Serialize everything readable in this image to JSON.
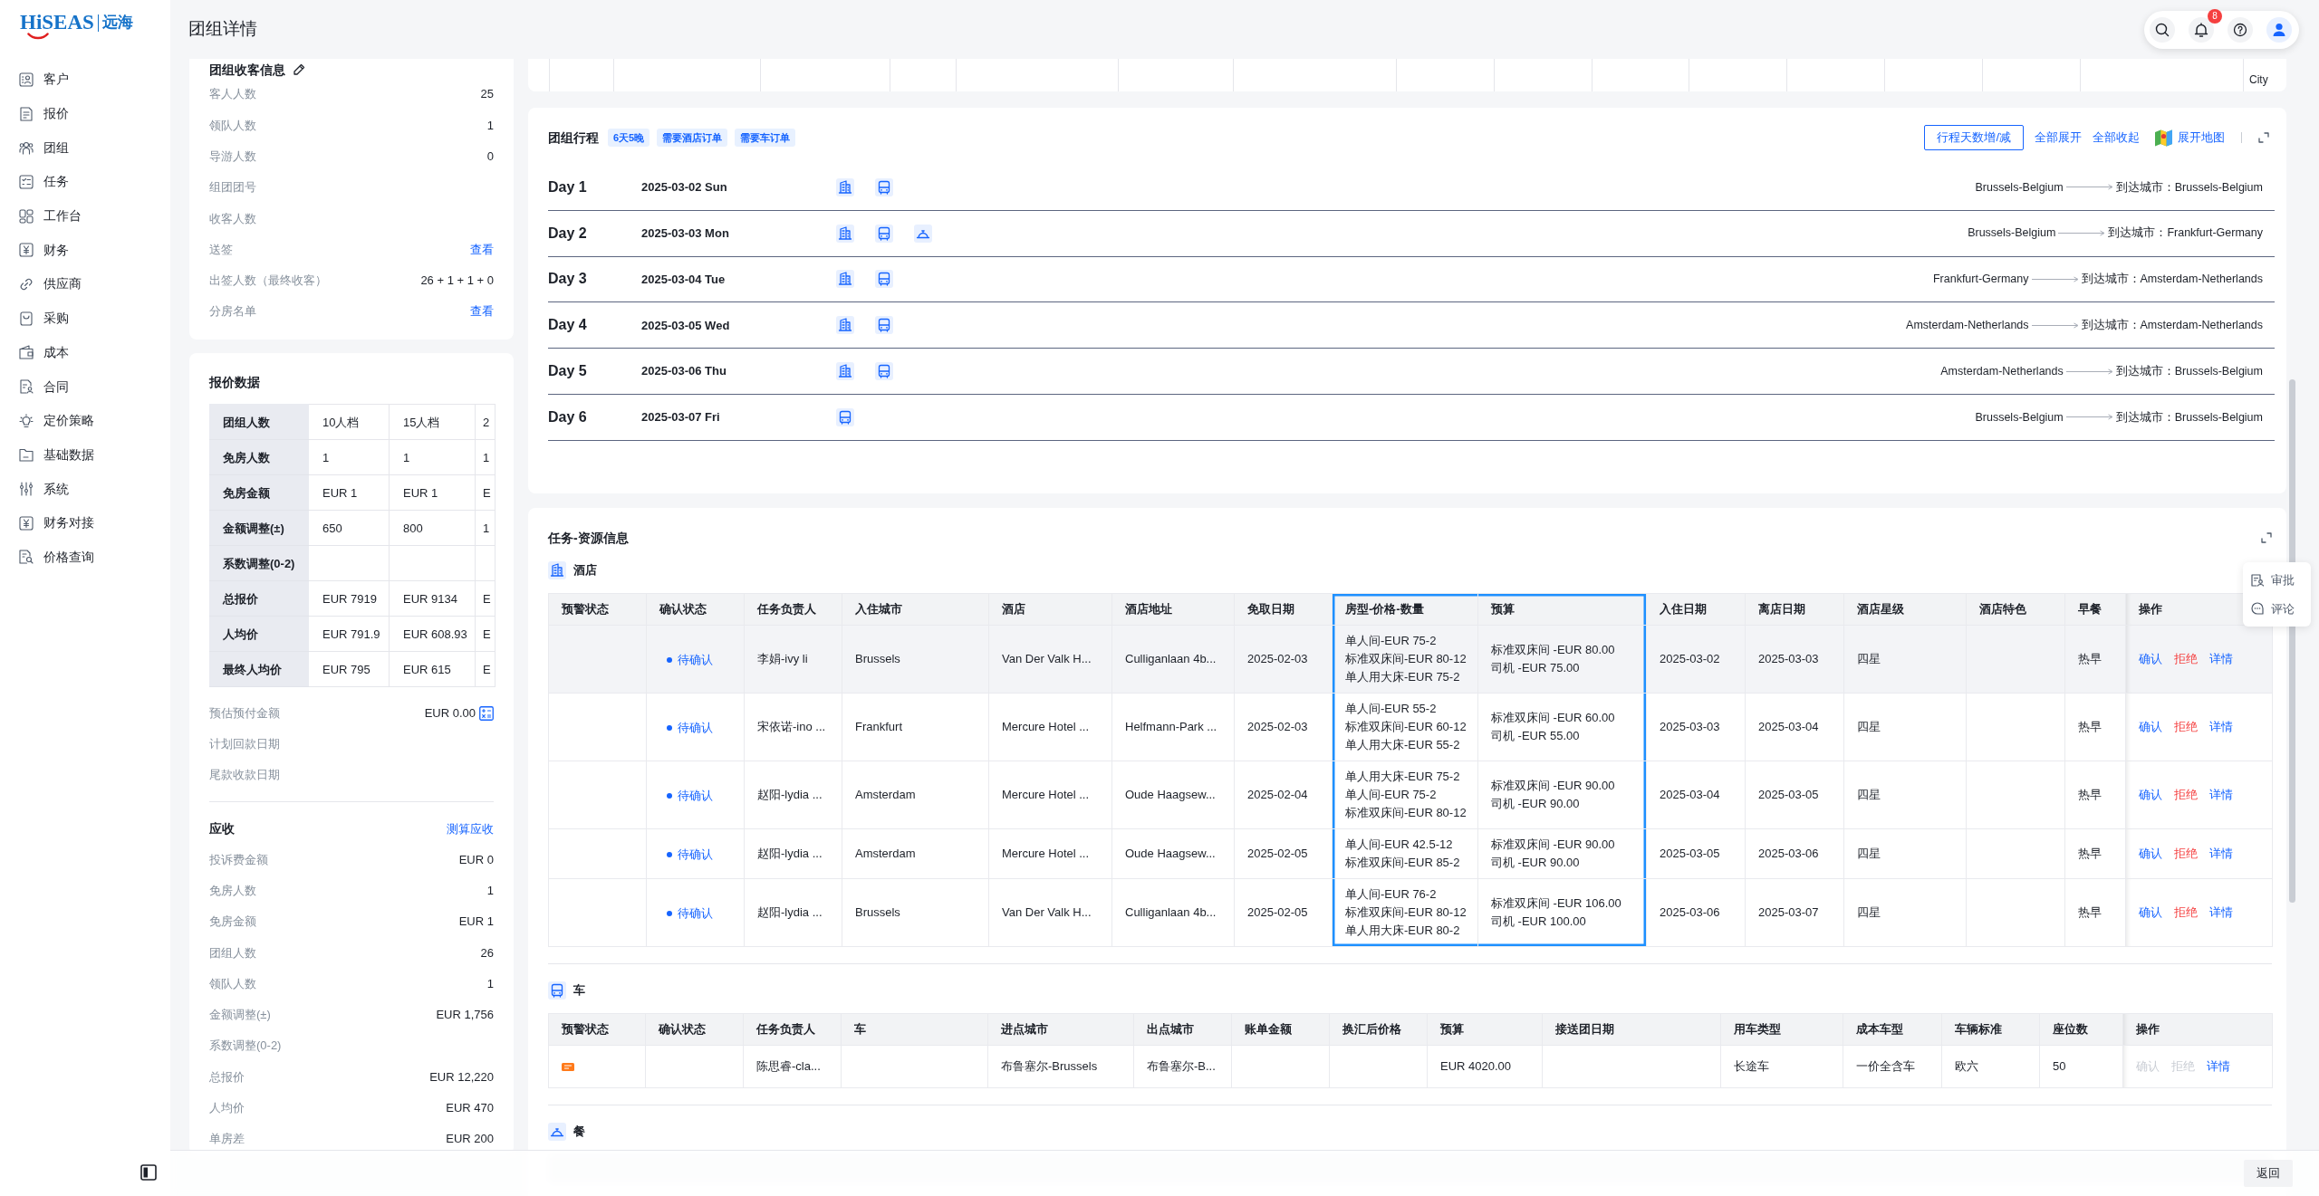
{
  "sidebar": {
    "logo": {
      "latin": "HiSEAS",
      "chinese": "远海"
    },
    "items": [
      {
        "label": "客户",
        "selected": false
      },
      {
        "label": "报价",
        "selected": false
      },
      {
        "label": "团组",
        "selected": false
      },
      {
        "label": "任务",
        "selected": false
      },
      {
        "label": "工作台",
        "selected": false
      },
      {
        "label": "财务",
        "selected": false
      },
      {
        "label": "供应商",
        "selected": false
      },
      {
        "label": "采购",
        "selected": false
      },
      {
        "label": "成本",
        "selected": false
      },
      {
        "label": "合同",
        "selected": false
      },
      {
        "label": "定价策略",
        "selected": false
      },
      {
        "label": "基础数据",
        "selected": false
      },
      {
        "label": "系统",
        "selected": false
      },
      {
        "label": "财务对接",
        "selected": false
      },
      {
        "label": "价格查询",
        "selected": false
      }
    ]
  },
  "header": {
    "title": "团组详情",
    "notification_count": "8"
  },
  "group_info": {
    "title": "团组收客信息",
    "rows": [
      {
        "kind": "value",
        "label": "客人人数",
        "value": "25"
      },
      {
        "kind": "value",
        "label": "领队人数",
        "value": "1"
      },
      {
        "kind": "value",
        "label": "导游人数",
        "value": "0"
      },
      {
        "kind": "value",
        "label": "组团团号"
      },
      {
        "kind": "value",
        "label": "收客人数"
      },
      {
        "kind": "link",
        "label": "送签",
        "value": "查看"
      },
      {
        "kind": "value",
        "label": "出签人数（最终收客）",
        "value": "26 + 1 + 1 + 0"
      },
      {
        "kind": "link",
        "label": "分房名单",
        "value": "查看"
      }
    ]
  },
  "quote": {
    "title": "报价数据",
    "table": [
      {
        "label": "团组人数",
        "cells": [
          "10人档",
          "15人档",
          "2"
        ]
      },
      {
        "label": "免房人数",
        "cells": [
          "1",
          "1",
          "1"
        ]
      },
      {
        "label": "免房金额",
        "cells": [
          "EUR 1",
          "EUR 1",
          "E"
        ]
      },
      {
        "label": "金额调整(±)",
        "cells": [
          "650",
          "800",
          "1"
        ]
      },
      {
        "label": "系数调整(0-2)"
      },
      {
        "label": "总报价",
        "cells": [
          "EUR 7919",
          "EUR 9134",
          "E"
        ]
      },
      {
        "label": "人均价",
        "cells": [
          "EUR 791.9",
          "EUR 608.93",
          "E"
        ]
      },
      {
        "label": "最终人均价",
        "cells": [
          "EUR 795",
          "EUR 615",
          "E"
        ]
      }
    ],
    "details": [
      {
        "kind": "calculator",
        "label": "预估预付金额",
        "value": "EUR 0.00"
      },
      {
        "kind": "value",
        "label": "计划回款日期"
      },
      {
        "kind": "value",
        "label": "尾款收款日期"
      }
    ],
    "receivable": {
      "title": "应收",
      "link": "测算应收",
      "rows": [
        {
          "label": "投诉费金额",
          "value": "EUR 0"
        },
        {
          "label": "免房人数",
          "value": "1"
        },
        {
          "label": "免房金额",
          "value": "EUR 1"
        },
        {
          "label": "团组人数",
          "value": "26"
        },
        {
          "label": "领队人数",
          "value": "1"
        },
        {
          "label": "金额调整(±)",
          "value": "EUR 1,756"
        },
        {
          "label": "系数调整(0-2)"
        },
        {
          "label": "总报价",
          "value": "EUR 12,220"
        },
        {
          "label": "人均价",
          "value": "EUR 470"
        },
        {
          "label": "单房差",
          "value": "EUR 200"
        }
      ]
    }
  },
  "table_strip": {
    "last_cell": "City"
  },
  "itinerary": {
    "title": "团组行程",
    "tags": [
      "6天5晚",
      "需要酒店订单",
      "需要车订单"
    ],
    "adjust_button": "行程天数增/减",
    "expand_all": "全部展开",
    "collapse_all": "全部收起",
    "map_link": "展开地图",
    "days": [
      {
        "day": "Day 1",
        "date": "2025-03-02 Sun",
        "services": [
          {
            "kind": "hotel"
          },
          {
            "kind": "bus"
          }
        ],
        "from": "Brussels-Belgium",
        "to": "到达城市：Brussels-Belgium"
      },
      {
        "day": "Day 2",
        "date": "2025-03-03 Mon",
        "services": [
          {
            "kind": "hotel"
          },
          {
            "kind": "bus"
          },
          {
            "kind": "meal"
          }
        ],
        "from": "Brussels-Belgium",
        "to": "到达城市：Frankfurt-Germany"
      },
      {
        "day": "Day 3",
        "date": "2025-03-04 Tue",
        "services": [
          {
            "kind": "hotel"
          },
          {
            "kind": "bus"
          }
        ],
        "from": "Frankfurt-Germany",
        "to": "到达城市：Amsterdam-Netherlands"
      },
      {
        "day": "Day 4",
        "date": "2025-03-05 Wed",
        "services": [
          {
            "kind": "hotel"
          },
          {
            "kind": "bus"
          }
        ],
        "from": "Amsterdam-Netherlands",
        "to": "到达城市：Amsterdam-Netherlands"
      },
      {
        "day": "Day 5",
        "date": "2025-03-06 Thu",
        "services": [
          {
            "kind": "hotel"
          },
          {
            "kind": "bus"
          }
        ],
        "from": "Amsterdam-Netherlands",
        "to": "到达城市：Brussels-Belgium"
      },
      {
        "day": "Day 6",
        "date": "2025-03-07 Fri",
        "services": [
          {
            "kind": "bus"
          }
        ],
        "from": "Brussels-Belgium",
        "to": "到达城市：Brussels-Belgium"
      }
    ]
  },
  "tasks": {
    "title": "任务-资源信息",
    "sections": [
      {
        "kind": "hotel",
        "title": "酒店",
        "columns": [
          {
            "label": "预警状态",
            "framed": false
          },
          {
            "label": "确认状态",
            "framed": false
          },
          {
            "label": "任务负责人",
            "framed": false
          },
          {
            "label": "入住城市",
            "framed": false
          },
          {
            "label": "酒店",
            "framed": false
          },
          {
            "label": "酒店地址",
            "framed": false
          },
          {
            "label": "免取日期",
            "framed": false
          },
          {
            "label": "房型-价格-数量",
            "framed": true
          },
          {
            "label": "预算",
            "framed": true
          },
          {
            "label": "入住日期",
            "framed": false
          },
          {
            "label": "离店日期",
            "framed": false
          },
          {
            "label": "酒店星级",
            "framed": false
          },
          {
            "label": "酒店特色",
            "framed": false
          },
          {
            "label": "早餐",
            "framed": false
          },
          {
            "label": "操作",
            "framed": false
          }
        ],
        "rows": [
          {
            "highlighted": true,
            "warning_flag": false,
            "status": "待确认",
            "owner": "李娟-ivy li",
            "city": "Brussels",
            "hotel": "Van Der Valk H...",
            "address": "Culliganlaan 4b...",
            "free_date": "2025-02-03",
            "rooms": [
              "单人间-EUR 75-2",
              "标准双床间-EUR 80-12",
              "单人用大床-EUR 75-2"
            ],
            "budget": [
              "标准双床间 -EUR 80.00",
              "司机 -EUR 75.00"
            ],
            "check_in": "2025-03-02",
            "check_out": "2025-03-03",
            "star_rating": "四星",
            "breakfast": "热早",
            "actions": [
              {
                "kind": "confirm",
                "label": "确认",
                "disabled": false
              },
              {
                "kind": "reject",
                "label": "拒绝",
                "disabled": false
              },
              {
                "kind": "detail",
                "label": "详情",
                "disabled": false
              }
            ]
          },
          {
            "highlighted": false,
            "warning_flag": false,
            "status": "待确认",
            "owner": "宋依诺-ino ...",
            "city": "Frankfurt",
            "hotel": "Mercure Hotel ...",
            "address": "Helfmann-Park ...",
            "free_date": "2025-02-03",
            "rooms": [
              "单人间-EUR 55-2",
              "标准双床间-EUR 60-12",
              "单人用大床-EUR 55-2"
            ],
            "budget": [
              "标准双床间 -EUR 60.00",
              "司机 -EUR 55.00"
            ],
            "check_in": "2025-03-03",
            "check_out": "2025-03-04",
            "star_rating": "四星",
            "breakfast": "热早",
            "actions": [
              {
                "kind": "confirm",
                "label": "确认",
                "disabled": false
              },
              {
                "kind": "reject",
                "label": "拒绝",
                "disabled": false
              },
              {
                "kind": "detail",
                "label": "详情",
                "disabled": false
              }
            ]
          },
          {
            "highlighted": false,
            "warning_flag": false,
            "status": "待确认",
            "owner": "赵阳-lydia ...",
            "city": "Amsterdam",
            "hotel": "Mercure Hotel ...",
            "address": "Oude Haagsew...",
            "free_date": "2025-02-04",
            "rooms": [
              "单人用大床-EUR 75-2",
              "单人间-EUR 75-2",
              "标准双床间-EUR 80-12"
            ],
            "budget": [
              "标准双床间 -EUR 90.00",
              "司机 -EUR 90.00"
            ],
            "check_in": "2025-03-04",
            "check_out": "2025-03-05",
            "star_rating": "四星",
            "breakfast": "热早",
            "actions": [
              {
                "kind": "confirm",
                "label": "确认",
                "disabled": false
              },
              {
                "kind": "reject",
                "label": "拒绝",
                "disabled": false
              },
              {
                "kind": "detail",
                "label": "详情",
                "disabled": false
              }
            ]
          },
          {
            "highlighted": false,
            "warning_flag": false,
            "status": "待确认",
            "owner": "赵阳-lydia ...",
            "city": "Amsterdam",
            "hotel": "Mercure Hotel ...",
            "address": "Oude Haagsew...",
            "free_date": "2025-02-05",
            "rooms": [
              "单人间-EUR 42.5-12",
              "标准双床间-EUR 85-2"
            ],
            "budget": [
              "标准双床间 -EUR 90.00",
              "司机 -EUR 90.00"
            ],
            "check_in": "2025-03-05",
            "check_out": "2025-03-06",
            "star_rating": "四星",
            "breakfast": "热早",
            "actions": [
              {
                "kind": "confirm",
                "label": "确认",
                "disabled": false
              },
              {
                "kind": "reject",
                "label": "拒绝",
                "disabled": false
              },
              {
                "kind": "detail",
                "label": "详情",
                "disabled": false
              }
            ]
          },
          {
            "highlighted": false,
            "warning_flag": false,
            "status": "待确认",
            "owner": "赵阳-lydia ...",
            "city": "Brussels",
            "hotel": "Van Der Valk H...",
            "address": "Culliganlaan 4b...",
            "free_date": "2025-02-05",
            "rooms": [
              "单人间-EUR 76-2",
              "标准双床间-EUR 80-12",
              "单人用大床-EUR 80-2"
            ],
            "budget": [
              "标准双床间 -EUR 106.00",
              "司机 -EUR 100.00"
            ],
            "check_in": "2025-03-06",
            "check_out": "2025-03-07",
            "star_rating": "四星",
            "breakfast": "热早",
            "actions": [
              {
                "kind": "confirm",
                "label": "确认",
                "disabled": false
              },
              {
                "kind": "reject",
                "label": "拒绝",
                "disabled": false
              },
              {
                "kind": "detail",
                "label": "详情",
                "disabled": false
              }
            ]
          }
        ]
      },
      {
        "kind": "car",
        "title": "车",
        "columns": [
          {
            "label": "预警状态",
            "framed": false
          },
          {
            "label": "确认状态",
            "framed": false
          },
          {
            "label": "任务负责人",
            "framed": false
          },
          {
            "label": "车",
            "framed": false
          },
          {
            "label": "进点城市",
            "framed": false
          },
          {
            "label": "出点城市",
            "framed": false
          },
          {
            "label": "账单金额",
            "framed": false
          },
          {
            "label": "换汇后价格",
            "framed": false
          },
          {
            "label": "预算",
            "framed": false
          },
          {
            "label": "接送团日期",
            "framed": false
          },
          {
            "label": "用车类型",
            "framed": false
          },
          {
            "label": "成本车型",
            "framed": false
          },
          {
            "label": "车辆标准",
            "framed": false
          },
          {
            "label": "座位数",
            "framed": false
          },
          {
            "label": "操作",
            "framed": false
          }
        ],
        "rows": [
          {
            "warning_flag": true,
            "owner": "陈思睿-cla...",
            "entry_city": "布鲁塞尔-Brussels",
            "exit_city": "布鲁塞尔-B...",
            "budget": "EUR 4020.00",
            "usage_type": "长途车",
            "cost_model": "一价全含车",
            "standard": "欧六",
            "seats": "50",
            "actions": [
              {
                "kind": "confirm",
                "label": "确认",
                "disabled": true
              },
              {
                "kind": "reject",
                "label": "拒绝",
                "disabled": true
              },
              {
                "kind": "detail",
                "label": "详情",
                "disabled": false
              }
            ]
          }
        ]
      },
      {
        "kind": "meal",
        "title": "餐"
      }
    ]
  },
  "side_actions": [
    {
      "label": "审批"
    },
    {
      "label": "评论"
    }
  ],
  "footer": {
    "back_button": "返回"
  }
}
